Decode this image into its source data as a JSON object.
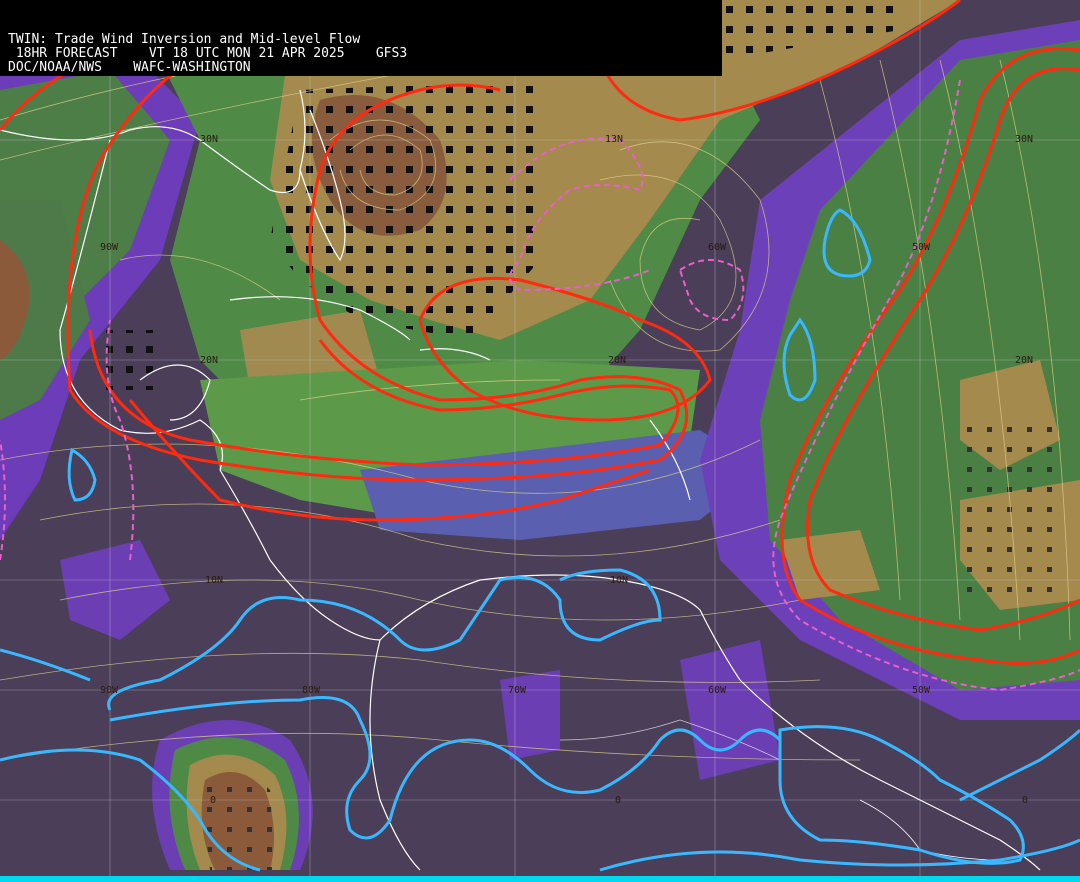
{
  "header": {
    "line1": "TWIN: Trade Wind Inversion and Mid-level Flow",
    "line2": " 18HR FORECAST    VT 18 UTC MON 21 APR 2025    GFS3",
    "line3": "DOC/NOAA/NWS    WAFC-WASHINGTON"
  },
  "grid_labels": {
    "lat_30n_left": "30N",
    "lat_30n_right": "30N",
    "lat_20n_left": "20N",
    "lat_20n_mid": "20N",
    "lat_20n_right": "20N",
    "lat_10n": "10N",
    "lat_10n_mid": "10N",
    "lat_0_left": "0",
    "lat_0_mid": "0",
    "lat_0_right": "0",
    "lon_90w_top": "90W",
    "lon_90w_bottom": "90W",
    "lon_80w": "80W",
    "lon_70w": "70W",
    "lon_60w_top": "60W",
    "lon_60w_bottom": "60W",
    "lon_50w_top": "50W",
    "lon_50w_bottom": "50W",
    "lon_13n": "13N"
  },
  "colors": {
    "background_dark": "#4a3e58",
    "purple": "#7a3cc0",
    "blue_violet": "#5a60b8",
    "green": "#4e8a48",
    "light_green": "#6fa050",
    "tan": "#a88a48",
    "brown": "#8a5a3a",
    "red_contour": "#ff2a10",
    "pink_dashed": "#e860c8",
    "cyan_contour": "#3ab8ff",
    "streamline": "#e8d890",
    "coastline": "#ffffff",
    "grid": "#c8c8d0"
  }
}
